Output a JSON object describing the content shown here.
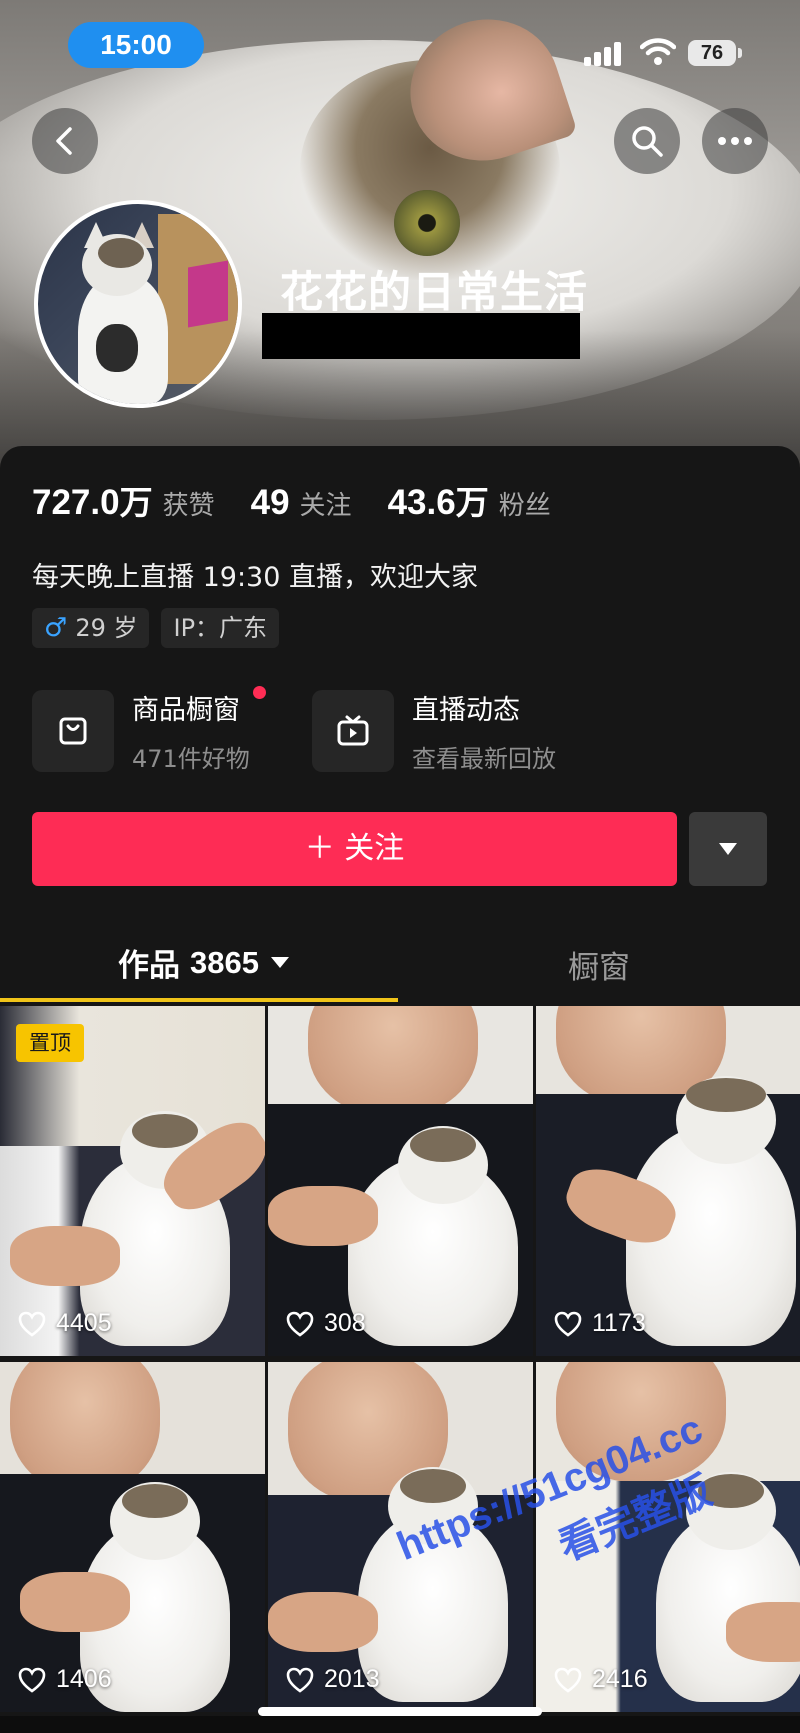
{
  "status_bar": {
    "time": "15:00",
    "battery": "76"
  },
  "profile": {
    "name": "花花的日常生活",
    "bio": "每天晚上直播 19:30 直播，欢迎大家",
    "tags": [
      {
        "icon": "male-icon",
        "label": "29 岁"
      },
      {
        "label": "IP：广东"
      }
    ]
  },
  "stats": [
    {
      "num": "727.0",
      "unit": "万",
      "label": "获赞"
    },
    {
      "num": "49",
      "unit": "",
      "label": "关注"
    },
    {
      "num": "43.6",
      "unit": "万",
      "label": "粉丝"
    }
  ],
  "features": {
    "shop": {
      "title": "商品橱窗",
      "sub": "471件好物",
      "icon": "shopping-bag-icon"
    },
    "live": {
      "title": "直播动态",
      "sub": "查看最新回放",
      "icon": "tv-icon"
    }
  },
  "actions": {
    "follow_label": "＋ 关注"
  },
  "tabs": {
    "works_label": "作品",
    "works_count": "3865",
    "window_label": "橱窗"
  },
  "grid": {
    "pin_label": "置顶",
    "likes": [
      "4405",
      "308",
      "1173",
      "1406",
      "2013",
      "2416"
    ]
  },
  "watermark": {
    "line1": "https://51cg04.cc",
    "line2": "看完整版"
  },
  "colors": {
    "accent": "#fe2c55",
    "tab_indicator": "#f0c419",
    "pin_badge": "#f7c400",
    "time_pill": "#1f8ff0"
  }
}
